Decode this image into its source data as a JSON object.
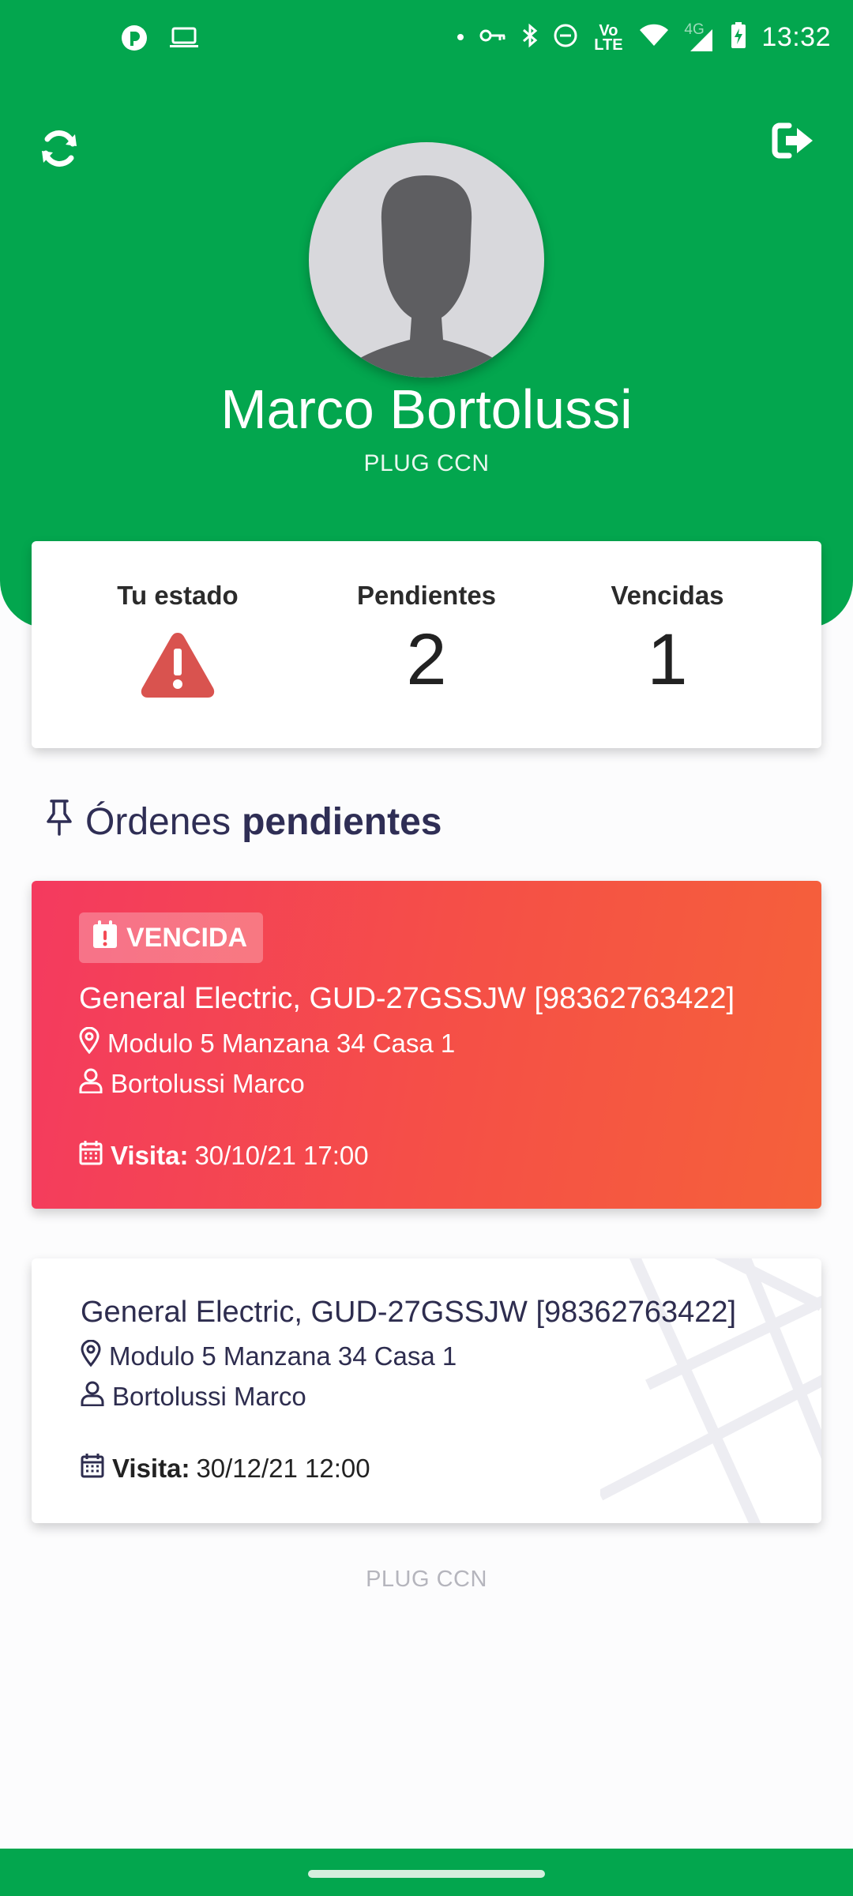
{
  "status_bar": {
    "time": "13:32",
    "network_labels": {
      "volte": "Vo LTE",
      "generation": "4G"
    }
  },
  "header": {
    "user_name": "Marco Bortolussi",
    "company": "PLUG CCN",
    "refresh_icon": "refresh-icon",
    "logout_icon": "logout-icon"
  },
  "stats": {
    "estado_label": "Tu estado",
    "estado_icon": "warning-triangle-icon",
    "pendientes_label": "Pendientes",
    "pendientes_value": "2",
    "vencidas_label": "Vencidas",
    "vencidas_value": "1"
  },
  "section": {
    "title_part1": "Órdenes",
    "title_part2": "pendientes"
  },
  "orders": [
    {
      "badge": "VENCIDA",
      "title": "General Electric, GUD-27GSSJW [98362763422]",
      "address": "Modulo 5 Manzana 34 Casa 1",
      "client": "Bortolussi Marco",
      "visit_label": "Visita:",
      "visit_value": "30/10/21 17:00"
    },
    {
      "title": "General Electric, GUD-27GSSJW [98362763422]",
      "address": "Modulo 5 Manzana 34 Casa 1",
      "client": "Bortolussi Marco",
      "visit_label": "Visita:",
      "visit_value": "30/12/21 12:00"
    }
  ],
  "footer": {
    "text": "PLUG CCN"
  },
  "colors": {
    "primary": "#03a64e",
    "overdue_start": "#f43a5f",
    "overdue_end": "#f5613a",
    "warning": "#d9534f",
    "title_text": "#2f2e55"
  }
}
